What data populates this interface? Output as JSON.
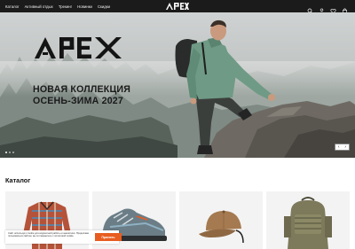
{
  "nav": {
    "links": [
      "Каталог",
      "Активный отдых",
      "Трекинг",
      "Новинки",
      "Скидки"
    ],
    "brand": "APEX",
    "icons": [
      "search-icon",
      "user-icon",
      "heart-icon",
      "cart-icon"
    ]
  },
  "hero": {
    "logo": "APEX",
    "title_line1": "Новая коллекция",
    "title_line2": "Осень-Зима 2027",
    "slides_count": 3,
    "active_slide": 1,
    "prev": "‹",
    "next": "›"
  },
  "catalog": {
    "title": "Каталог",
    "cards": [
      {
        "product": "plaid-shirt"
      },
      {
        "product": "hiking-shoe"
      },
      {
        "product": "cap"
      },
      {
        "product": "tactical-backpack"
      }
    ]
  },
  "cookie": {
    "text": "Сайт использует cookie для корректной работы и аналитики. Продолжая пользоваться сайтом, вы соглашаетесь с политикой cookie.",
    "button": "Принять"
  },
  "colors": {
    "nav_bg": "#1b1b1b",
    "accent": "#e85c1f",
    "card_bg": "#f3f3f3",
    "jacket": "#6f9a86"
  }
}
